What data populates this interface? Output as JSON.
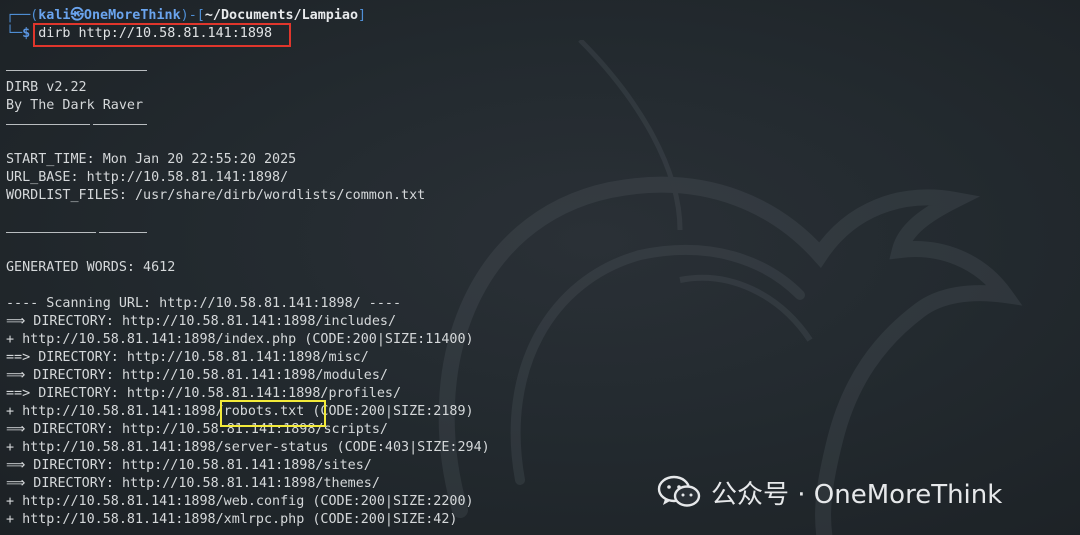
{
  "prompt": {
    "user_host": "kali㉿OneMoreThink",
    "path": "~/Documents/Lampiao",
    "dollar": "$",
    "command": "dirb http://10.58.81.141:1898"
  },
  "banner": {
    "name": "DIRB v2.22",
    "author": "By The Dark Raver"
  },
  "config": {
    "start_time": "START_TIME: Mon Jan 20 22:55:20 2025",
    "url_base": "URL_BASE: http://10.58.81.141:1898/",
    "wordlist": "WORDLIST_FILES: /usr/share/dirb/wordlists/common.txt"
  },
  "generated_words": "GENERATED WORDS: 4612",
  "scanning": "---- Scanning URL: http://10.58.81.141:1898/ ----",
  "results": [
    "⟹ DIRECTORY: http://10.58.81.141:1898/includes/",
    "+ http://10.58.81.141:1898/index.php (CODE:200|SIZE:11400)",
    "==> DIRECTORY: http://10.58.81.141:1898/misc/",
    "⟹ DIRECTORY: http://10.58.81.141:1898/modules/",
    "==> DIRECTORY: http://10.58.81.141:1898/profiles/",
    "+ http://10.58.81.141:1898/robots.txt (CODE:200|SIZE:2189)",
    "⟹ DIRECTORY: http://10.58.81.141:1898/scripts/",
    "+ http://10.58.81.141:1898/server-status (CODE:403|SIZE:294)",
    "⟹ DIRECTORY: http://10.58.81.141:1898/sites/",
    "⟹ DIRECTORY: http://10.58.81.141:1898/themes/",
    "+ http://10.58.81.141:1898/web.config (CODE:200|SIZE:2200)",
    "+ http://10.58.81.141:1898/xmlrpc.php (CODE:200|SIZE:42)"
  ],
  "watermark": {
    "icon": "wechat-icon",
    "text": "公众号 · OneMoreThink"
  },
  "colors": {
    "background": "#232a2f",
    "prompt_blue": "#4f8fd6",
    "highlight_red": "#e0362c",
    "highlight_yellow": "#f3ea3a"
  }
}
